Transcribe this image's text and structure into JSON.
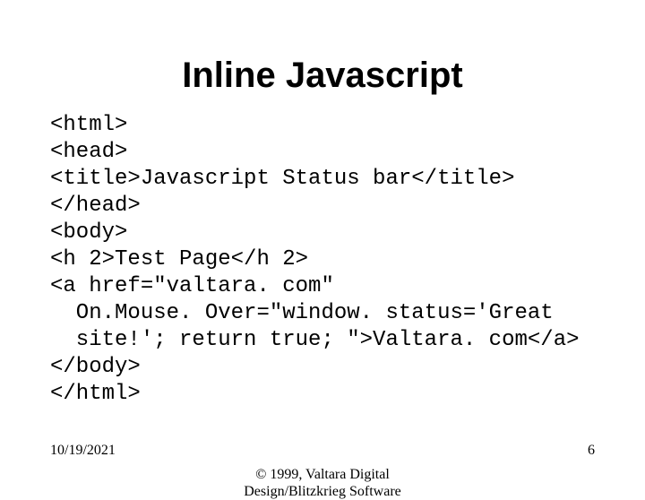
{
  "title": "Inline Javascript",
  "code_lines": [
    "<html>",
    "<head>",
    "<title>Javascript Status bar</title>",
    "</head>",
    "<body>",
    "<h 2>Test Page</h 2>",
    "<a href=\"valtara. com\"",
    "  On.Mouse. Over=\"window. status='Great",
    "  site!'; return true; \">Valtara. com</a>",
    "</body>",
    "</html>"
  ],
  "footer": {
    "date": "10/19/2021",
    "copyright_line1": "© 1999, Valtara Digital",
    "copyright_line2": "Design/Blitzkrieg Software",
    "page_number": "6"
  }
}
